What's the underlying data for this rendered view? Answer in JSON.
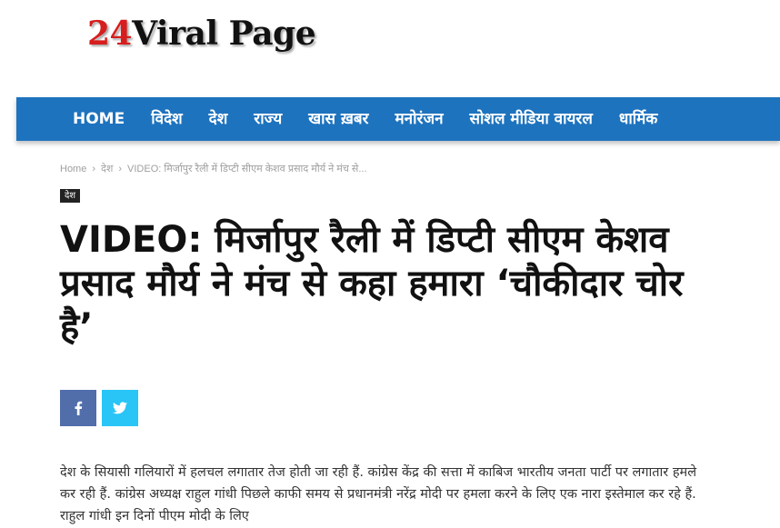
{
  "logo": {
    "number": "24",
    "text": "Viral Page"
  },
  "nav": {
    "items": [
      "HOME",
      "विदेश",
      "देश",
      "राज्य",
      "खास ख़बर",
      "मनोरंजन",
      "सोशल मीडिया वायरल",
      "धार्मिक"
    ]
  },
  "breadcrumb": {
    "home": "Home",
    "category": "देश",
    "current": "VIDEO: मिर्जापुर रैली में डिप्टी सीएम केशव प्रसाद मौर्य ने मंच से..."
  },
  "category_badge": "देश",
  "article": {
    "title": "VIDEO: मिर्जापुर रैली में डिप्टी सीएम केशव प्रसाद मौर्य ने मंच से कहा हमारा ‘चौकीदार चोर है’",
    "body": "देश के सियासी गलियारों में हलचल लगातार तेज होती जा रही हैं. कांग्रेस केंद्र की सत्ता में काबिज भारतीय जनता पार्टी पर लगातार हमले कर रही हैं. कांग्रेस अध्यक्ष राहुल गांधी पिछले काफी समय से प्रधानमंत्री नरेंद्र मोदी पर हमला करने के लिए एक नारा इस्तेमाल कर रहे हैं. राहुल गांधी इन दिनों पीएम मोदी के लिए"
  },
  "share": {
    "facebook_icon": "facebook-icon",
    "twitter_icon": "twitter-icon"
  },
  "colors": {
    "nav_bg": "#1e73be",
    "logo_number": "#d71d1d",
    "facebook": "#516eab",
    "twitter": "#29c5f6"
  }
}
